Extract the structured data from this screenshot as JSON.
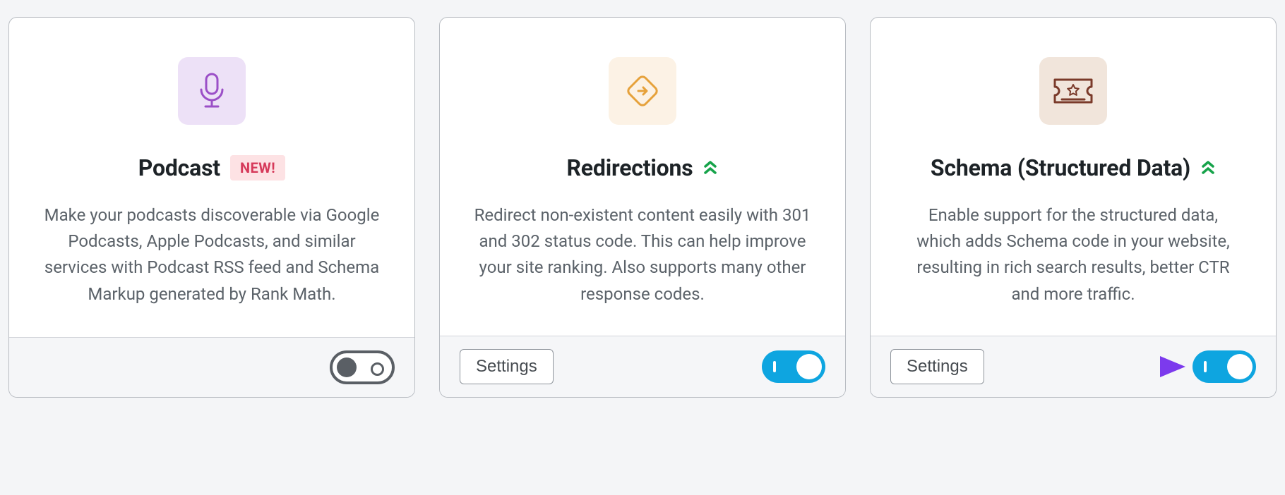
{
  "cards": [
    {
      "id": "podcast",
      "title": "Podcast",
      "badge": "NEW!",
      "description": "Make your podcasts discoverable via Google Podcasts, Apple Podcasts, and similar services with Podcast RSS feed and Schema Markup generated by Rank Math.",
      "has_chevrons": false,
      "has_settings": false,
      "toggle_on": false,
      "has_arrow": false,
      "icon": "microphone",
      "icon_bg": "purple"
    },
    {
      "id": "redirections",
      "title": "Redirections",
      "badge": null,
      "description": "Redirect non-existent content easily with 301 and 302 status code. This can help improve your site ranking. Also supports many other response codes.",
      "has_chevrons": true,
      "has_settings": true,
      "toggle_on": true,
      "has_arrow": false,
      "icon": "redirect",
      "icon_bg": "orange"
    },
    {
      "id": "schema",
      "title": "Schema (Structured Data)",
      "badge": null,
      "description": "Enable support for the structured data, which adds Schema code in your website, resulting in rich search results, better CTR and more traffic.",
      "has_chevrons": true,
      "has_settings": true,
      "toggle_on": true,
      "has_arrow": true,
      "icon": "ticket",
      "icon_bg": "brown"
    }
  ],
  "settings_label": "Settings"
}
